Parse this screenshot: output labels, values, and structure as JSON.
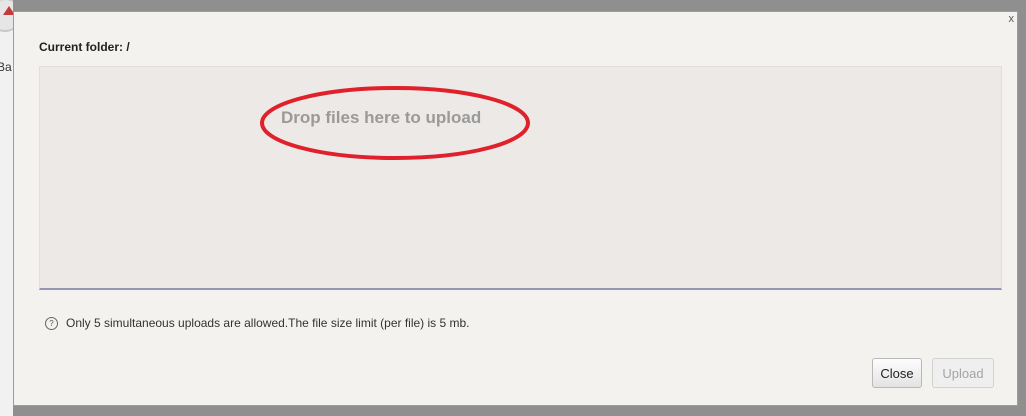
{
  "background_app": {
    "partial_label": "Ba"
  },
  "dialog": {
    "close_glyph": "x",
    "current_folder_label": "Current folder: /",
    "dropzone_text": "Drop files here to upload",
    "help_glyph": "?",
    "info_text": "Only 5 simultaneous uploads are allowed.The file size limit (per file) is 5 mb.",
    "close_button_label": "Close",
    "upload_button_label": "Upload",
    "upload_button_state": "disabled"
  },
  "colors": {
    "annotation_circle": "#e0202a",
    "dialog_background": "#f4f2ef",
    "dropzone_background": "#ece9e6",
    "dropzone_border_bottom": "#9595b8"
  }
}
